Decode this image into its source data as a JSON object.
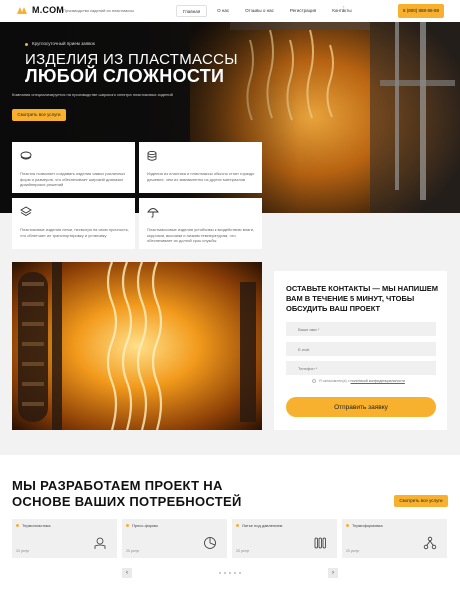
{
  "header": {
    "logo": "M.COM",
    "tagline": "Производство изделий из пластмассы",
    "nav": [
      "Главная",
      "О нас",
      "Отзывы о нас",
      "Регистрация",
      "Контакты"
    ],
    "more": "⫶",
    "phone": "8 (800) 888-88-88"
  },
  "hero": {
    "eyebrow": "Круглосуточный прием заявок",
    "line1": "ИЗДЕЛИЯ ИЗ ПЛАСТМАССЫ",
    "line2": "ЛЮБОЙ СЛОЖНОСТИ",
    "subtitle": "Компания специализируется на производстве широкого спектра пластиковых изделий",
    "button": "Смотреть все услуги"
  },
  "features": [
    {
      "icon": "layers-icon",
      "text": "Пластик позволяет создавать изделия самых различных форм и размеров, что обеспечивает широкий диапазон дизайнерских решений"
    },
    {
      "icon": "coins-icon",
      "text": "Изделия из пластика и пластмассы обычно стоят гораздо дешевле, чем их эквиваленты из других материалов"
    },
    {
      "icon": "stack-icon",
      "text": "Пластиковые изделия легки, несмотря на свою прочность, что облегчает их транспортировку и установку"
    },
    {
      "icon": "umbrella-icon",
      "text": "Пластмассовые изделия устойчивы к воздействию влаги, коррозии, высоким и низким температурам, что обеспечивает их долгий срок службы"
    }
  ],
  "form": {
    "title": "ОСТАВЬТЕ КОНТАКТЫ — МЫ НАПИШЕМ ВАМ В ТЕЧЕНИЕ 5 МИНУТ, ЧТОБЫ ОБСУДИТЬ ВАШ ПРОЕКТ",
    "name_placeholder": "Ваше имя *",
    "email_placeholder": "E-mail",
    "phone_placeholder": "Телефон *",
    "consent_text": "Я ознакомлен(а) с",
    "consent_link": "политикой конфиденциальности",
    "submit": "Отправить заявку"
  },
  "services": {
    "title": "МЫ РАЗРАБОТАЕМ ПРОЕКТ НА ОСНОВЕ ВАШИХ ПОТРЕБНОСТЕЙ",
    "button": "Смотреть все услуги",
    "items": [
      {
        "name": "Термопластика",
        "count": "20 услуг",
        "icon": "hand-gear-icon"
      },
      {
        "name": "Пресс-формы",
        "count": "20 услуг",
        "icon": "pie-chart-icon"
      },
      {
        "name": "Литье под давлением",
        "count": "20 услуг",
        "icon": "tubes-icon"
      },
      {
        "name": "Термоформовка",
        "count": "20 услуг",
        "icon": "network-icon"
      }
    ],
    "prev": "‹",
    "next": "›"
  }
}
